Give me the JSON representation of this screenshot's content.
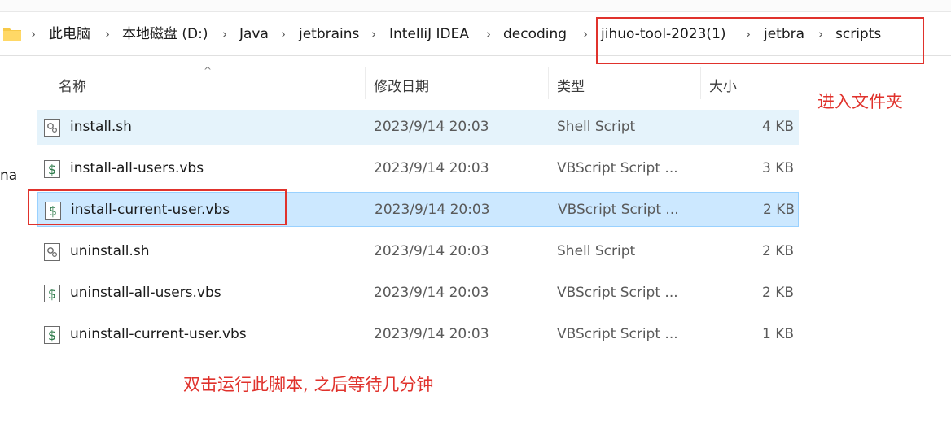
{
  "breadcrumb": [
    "此电脑",
    "本地磁盘 (D:)",
    "Java",
    "jetbrains",
    "IntelliJ IDEA",
    "decoding",
    "jihuo-tool-2023(1)",
    "jetbra",
    "scripts"
  ],
  "left_nav_fragment": "na",
  "columns": {
    "name": "名称",
    "date": "修改日期",
    "type": "类型",
    "size": "大小"
  },
  "files": [
    {
      "name": "install.sh",
      "date": "2023/9/14 20:03",
      "type": "Shell Script",
      "size": "4 KB",
      "icon": "shell-script-icon"
    },
    {
      "name": "install-all-users.vbs",
      "date": "2023/9/14 20:03",
      "type": "VBScript Script ...",
      "size": "3 KB",
      "icon": "vbscript-icon"
    },
    {
      "name": "install-current-user.vbs",
      "date": "2023/9/14 20:03",
      "type": "VBScript Script ...",
      "size": "2 KB",
      "icon": "vbscript-icon"
    },
    {
      "name": "uninstall.sh",
      "date": "2023/9/14 20:03",
      "type": "Shell Script",
      "size": "2 KB",
      "icon": "shell-script-icon"
    },
    {
      "name": "uninstall-all-users.vbs",
      "date": "2023/9/14 20:03",
      "type": "VBScript Script ...",
      "size": "2 KB",
      "icon": "vbscript-icon"
    },
    {
      "name": "uninstall-current-user.vbs",
      "date": "2023/9/14 20:03",
      "type": "VBScript Script ...",
      "size": "1 KB",
      "icon": "vbscript-icon"
    }
  ],
  "annotations": {
    "enter_folder": "进入文件夹",
    "double_click": "双击运行此脚本, 之后等待几分钟"
  },
  "colors": {
    "annotation_red": "#e0322c",
    "hover_row": "#e5f3fb",
    "selected_row": "#cce8ff"
  }
}
